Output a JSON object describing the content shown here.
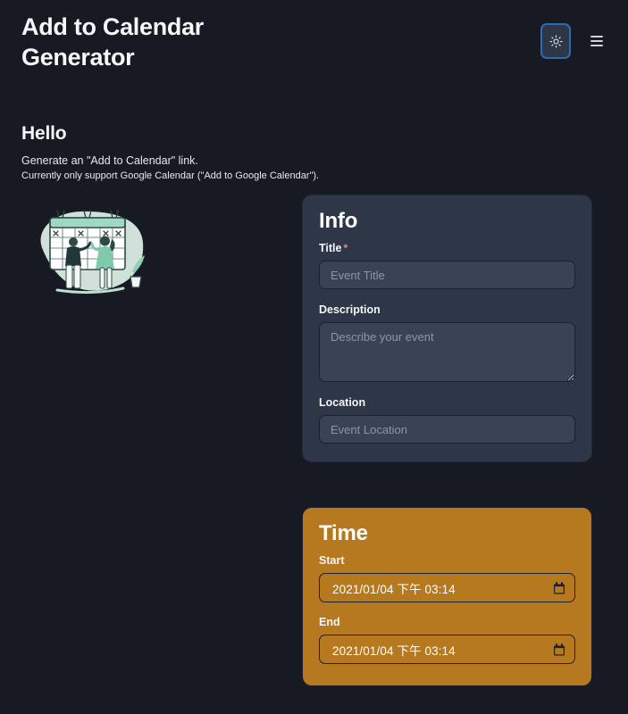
{
  "header": {
    "app_title": "Add to Calendar Generator",
    "theme_toggle_icon": "sun-icon",
    "theme_toggle_label": "Toggle color mode",
    "menu_icon": "hamburger-menu-icon",
    "menu_label": "Open menu",
    "accent_border_color": "#2b6cb0"
  },
  "intro": {
    "heading": "Hello",
    "line1": "Generate an \"Add to Calendar\" link.",
    "line2": "Currently only support Google Calendar (\"Add to Google Calendar\")."
  },
  "illustration": {
    "name": "calendar-planning-illustration",
    "alt": "Two people standing in front of a large wall calendar",
    "blob_color": "#d7ece2",
    "calendar_color": "#9fd9c3",
    "accent_color": "#2e4a44"
  },
  "cards": {
    "info": {
      "title": "Info",
      "background_color": "#2d3748",
      "fields": {
        "title": {
          "label": "Title",
          "required_marker": "*",
          "required_color": "#fc8181",
          "placeholder": "Event Title",
          "value": ""
        },
        "description": {
          "label": "Description",
          "placeholder": "Describe your event",
          "value": ""
        },
        "location": {
          "label": "Location",
          "placeholder": "Event Location",
          "value": ""
        }
      }
    },
    "time": {
      "title": "Time",
      "background_color": "#b7791f",
      "fields": {
        "start": {
          "label": "Start",
          "value": "2021/01/04 下午 03:14",
          "picker_icon": "calendar-icon"
        },
        "end": {
          "label": "End",
          "value": "2021/01/04 下午 03:14",
          "picker_icon": "calendar-icon"
        }
      }
    }
  },
  "colors": {
    "page_background": "#171923",
    "card_info": "#2d3748",
    "card_time": "#b7791f",
    "input_fill": "#3a4354",
    "text_primary": "#f5f7fa",
    "placeholder": "#8d96a5"
  }
}
